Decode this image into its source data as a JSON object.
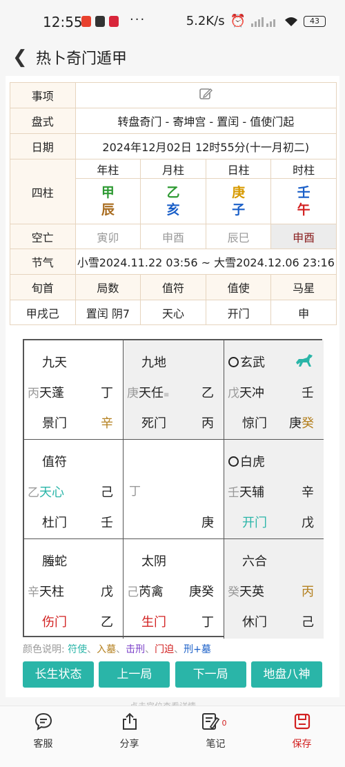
{
  "status": {
    "time": "12:55",
    "dots": "···",
    "speed": "5.2K/s",
    "battery": "43"
  },
  "header": {
    "title": "热卜奇门遁甲"
  },
  "info": {
    "shixiang_label": "事项",
    "panshi_label": "盘式",
    "panshi_value": "转盘奇门 - 寄坤宫 - 置闰 - 值使门起",
    "riqi_label": "日期",
    "riqi_value": "2024年12月02日 12时55分(十一月初二)",
    "sizhu_label": "四柱",
    "pillar_headers": [
      "年柱",
      "月柱",
      "日柱",
      "时柱"
    ],
    "pillars": [
      {
        "gan": "甲",
        "zhi": "辰",
        "gan_color": "#2e9a33",
        "zhi_color": "#a86b1e"
      },
      {
        "gan": "乙",
        "zhi": "亥",
        "gan_color": "#2e9a33",
        "zhi_color": "#1a5fc8"
      },
      {
        "gan": "庚",
        "zhi": "子",
        "gan_color": "#d79a00",
        "zhi_color": "#1a5fc8"
      },
      {
        "gan": "壬",
        "zhi": "午",
        "gan_color": "#1a5fc8",
        "zhi_color": "#d22020"
      }
    ],
    "kongwang_label": "空亡",
    "kongwang": [
      "寅卯",
      "申酉",
      "辰巳",
      "申酉"
    ],
    "jieqi_label": "节气",
    "jieqi_value": "小雪2024.11.22 03:56 ~ 大雪2024.12.06 23:16",
    "bottom_headers": [
      "旬首",
      "局数",
      "值符",
      "值使",
      "马星"
    ],
    "bottom_values": [
      "甲戌己",
      "置闰 阴7",
      "天心",
      "开门",
      "申"
    ]
  },
  "palaces": [
    {
      "god": "九天",
      "stem": "丙",
      "star": "天蓬",
      "star_color": "#222",
      "r1": "丁",
      "door": "景门",
      "door_color": "#222",
      "r2": "辛",
      "r2_color": "#b4801f"
    },
    {
      "god": "九地",
      "stem": "庚",
      "star": "天任",
      "star_color": "#222",
      "r1": "乙",
      "door": "死门",
      "door_color": "#222",
      "r2": "丙",
      "r2_color": "#222"
    },
    {
      "god": "玄武",
      "stem": "戊",
      "star": "天冲",
      "star_color": "#222",
      "r1": "壬",
      "door": "惊门",
      "door_color": "#222",
      "r2a": "庚",
      "r2": "癸",
      "r2_color": "#b4801f"
    },
    {
      "god": "值符",
      "stem": "乙",
      "star": "天心",
      "star_color": "#2ab5a8",
      "r1": "己",
      "door": "杜门",
      "door_color": "#222",
      "r2": "壬",
      "r2_color": "#222"
    },
    {
      "center_stem": "丁",
      "r2": "庚",
      "r2_color": "#222"
    },
    {
      "god": "白虎",
      "stem": "壬",
      "star": "天辅",
      "star_color": "#222",
      "r1": "辛",
      "door": "开门",
      "door_color": "#2ab5a8",
      "r2": "戊",
      "r2_color": "#222"
    },
    {
      "god": "螣蛇",
      "stem": "辛",
      "star": "天柱",
      "star_color": "#222",
      "r1": "戊",
      "door": "伤门",
      "door_color": "#d22020",
      "r2": "乙",
      "r2_color": "#222"
    },
    {
      "god": "太阴",
      "stem": "己",
      "star": "芮禽",
      "star_color": "#222",
      "r1": "庚癸",
      "door": "生门",
      "door_color": "#d22020",
      "r2": "丁",
      "r2_color": "#222"
    },
    {
      "god": "六合",
      "stem": "癸",
      "star": "天英",
      "star_color": "#222",
      "r1": "丙",
      "r1_color": "#b4801f",
      "door": "休门",
      "door_color": "#222",
      "r2": "己",
      "r2_color": "#222"
    }
  ],
  "legend": {
    "prefix": "颜色说明:",
    "items": [
      {
        "text": "符使",
        "color": "#2ab5a8"
      },
      {
        "text": "入墓",
        "color": "#b4801f"
      },
      {
        "text": "击刑",
        "color": "#7a3fc8"
      },
      {
        "text": "门迫",
        "color": "#d22020"
      },
      {
        "text": "刑+墓",
        "color": "#1a5fc8"
      }
    ]
  },
  "buttons": [
    "长生状态",
    "上一局",
    "下一局",
    "地盘八神"
  ],
  "cut_text": "点击宫位查看详情",
  "nav": [
    {
      "label": "客服",
      "icon": "chat-icon"
    },
    {
      "label": "分享",
      "icon": "share-icon"
    },
    {
      "label": "笔记",
      "icon": "note-icon",
      "badge": "0"
    },
    {
      "label": "保存",
      "icon": "save-icon",
      "color": "#d22020"
    }
  ],
  "colors": {
    "accent": "#2ab5a8",
    "label_bg": "#fdf7ef",
    "label_text": "#b9864f",
    "horse": "#2ab5a8"
  }
}
